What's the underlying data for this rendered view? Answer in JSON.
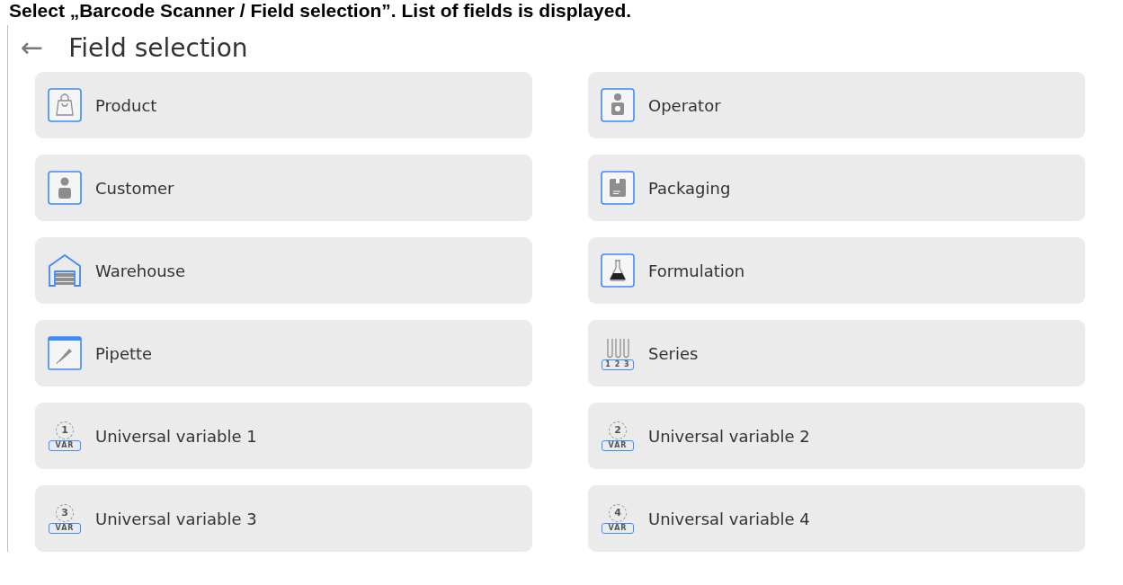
{
  "caption": "Select „Barcode Scanner / Field selection”. List of fields is displayed.",
  "header": {
    "back": "←",
    "title": "Field selection"
  },
  "fields": [
    {
      "kind": "product",
      "label": "Product"
    },
    {
      "kind": "operator",
      "label": "Operator"
    },
    {
      "kind": "customer",
      "label": "Customer"
    },
    {
      "kind": "packaging",
      "label": "Packaging"
    },
    {
      "kind": "warehouse",
      "label": "Warehouse"
    },
    {
      "kind": "formulation",
      "label": "Formulation"
    },
    {
      "kind": "pipette",
      "label": "Pipette"
    },
    {
      "kind": "series",
      "label": "Series",
      "icon_text": "1 2 3"
    },
    {
      "kind": "variable",
      "label": "Universal variable 1",
      "icon_number": "1",
      "icon_text": "VAR"
    },
    {
      "kind": "variable",
      "label": "Universal variable 2",
      "icon_number": "2",
      "icon_text": "VAR"
    },
    {
      "kind": "variable",
      "label": "Universal variable 3",
      "icon_number": "3",
      "icon_text": "VAR"
    },
    {
      "kind": "variable",
      "label": "Universal variable 4",
      "icon_number": "4",
      "icon_text": "VAR"
    }
  ]
}
